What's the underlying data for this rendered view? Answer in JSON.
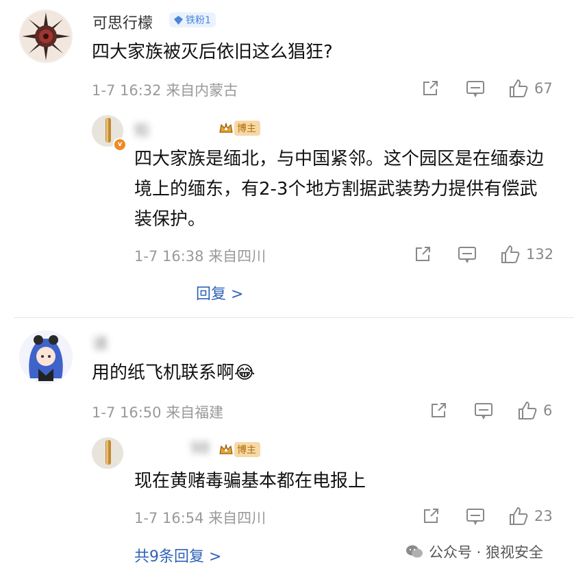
{
  "comment1": {
    "username": "可思行檬",
    "fan_badge": "铁粉1",
    "text": "四大家族被灭后依旧这么猖狂?",
    "time": "1-7 16:32",
    "location": "来自内蒙古",
    "likes": "67"
  },
  "reply1": {
    "username": "知",
    "host_badge": "博主",
    "text": "四大家族是缅北，与中国紧邻。这个园区是在缅泰边境上的缅东，有2-3个地方割据武装势力提供有偿武装保护。",
    "time": "1-7 16:38",
    "location": "来自四川",
    "likes": "132",
    "more_replies": "回复 >"
  },
  "comment2": {
    "username": "请",
    "text": "用的纸飞机联系啊",
    "emoji": "😂",
    "time": "1-7 16:50",
    "location": "来自福建",
    "likes": "6"
  },
  "reply2": {
    "username": "98",
    "host_badge": "博主",
    "text": "现在黄赌毒骗基本都在电报上",
    "time": "1-7 16:54",
    "location": "来自四川",
    "likes": "23",
    "more_replies": "共9条回复 >"
  },
  "watermark": {
    "text": "公众号 · 狼视安全"
  },
  "colors": {
    "link": "#2f63b8",
    "meta": "#999999",
    "host_badge_bg": "#f6d9a7",
    "fan_badge_bg": "#eaf2fd"
  }
}
